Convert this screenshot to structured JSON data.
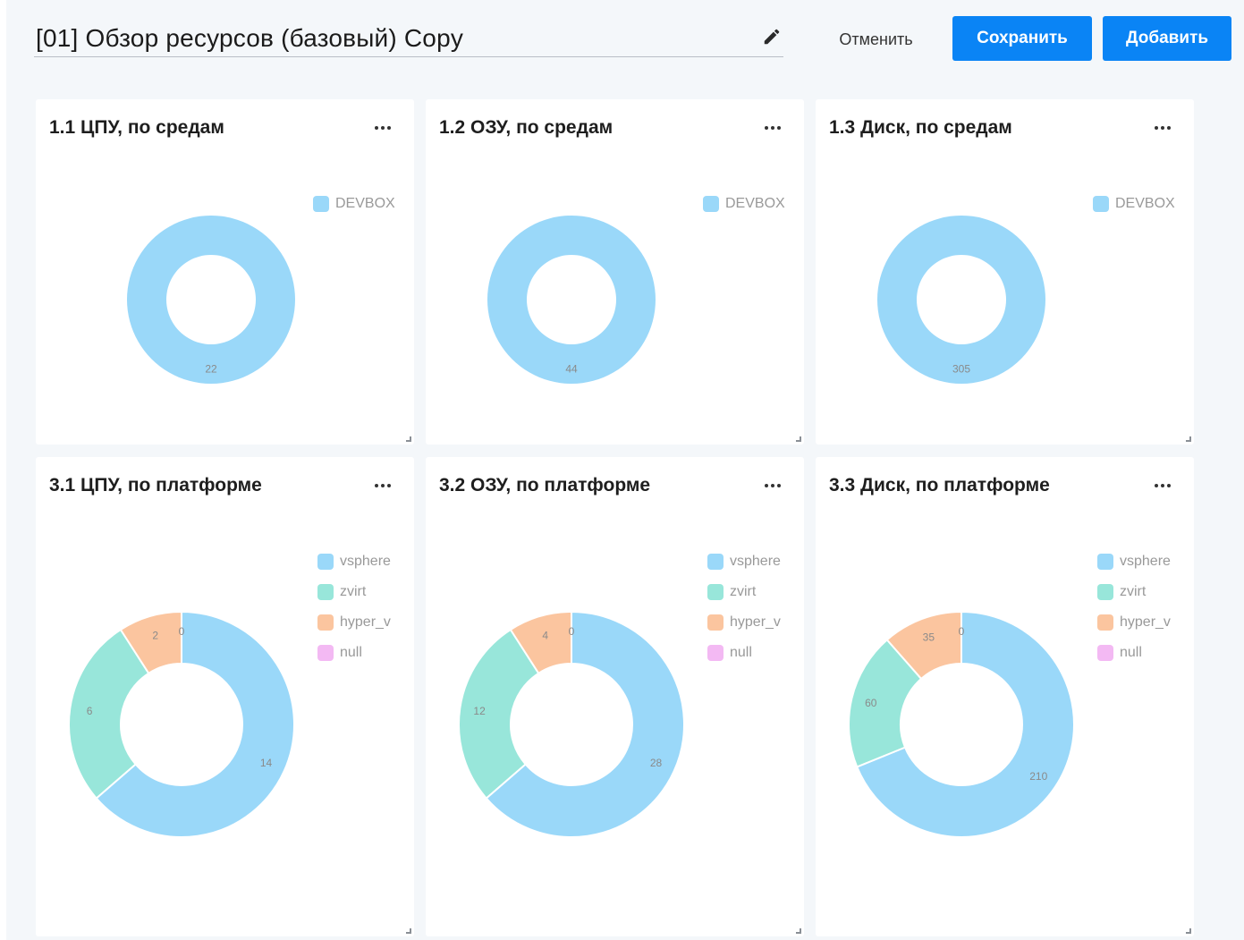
{
  "header": {
    "title": "[01] Обзор ресурсов  (базовый) Copy",
    "cancel_label": "Отменить",
    "save_label": "Сохранить",
    "add_label": "Добавить"
  },
  "colors": {
    "accent": "#0a84f5",
    "vsphere": "#9ad8f9",
    "zvirt": "#98e6da",
    "hyper_v": "#fbc59f",
    "null": "#f3b9f3",
    "devbox": "#9ad8f9"
  },
  "panels": [
    {
      "title": "1.1 ЦПУ, по средам"
    },
    {
      "title": "1.2 ОЗУ, по средам"
    },
    {
      "title": "1.3 Диск, по средам"
    },
    {
      "title": "3.1 ЦПУ, по платформе"
    },
    {
      "title": "3.2 ОЗУ, по платформе"
    },
    {
      "title": "3.3 Диск, по платформе"
    }
  ],
  "chart_data": [
    {
      "type": "pie",
      "title": "1.1 ЦПУ, по средам",
      "categories": [
        "DEVBOX"
      ],
      "values": [
        22
      ],
      "legend": "top-right",
      "donut": true
    },
    {
      "type": "pie",
      "title": "1.2 ОЗУ, по средам",
      "categories": [
        "DEVBOX"
      ],
      "values": [
        44
      ],
      "legend": "top-right",
      "donut": true
    },
    {
      "type": "pie",
      "title": "1.3 Диск, по средам",
      "categories": [
        "DEVBOX"
      ],
      "values": [
        305
      ],
      "legend": "top-right",
      "donut": true
    },
    {
      "type": "pie",
      "title": "3.1 ЦПУ, по платформе",
      "categories": [
        "vsphere",
        "zvirt",
        "hyper_v",
        "null"
      ],
      "values": [
        14,
        6,
        2,
        0
      ],
      "legend": "top-right",
      "donut": true
    },
    {
      "type": "pie",
      "title": "3.2 ОЗУ, по платформе",
      "categories": [
        "vsphere",
        "zvirt",
        "hyper_v",
        "null"
      ],
      "values": [
        28,
        12,
        4,
        0
      ],
      "legend": "top-right",
      "donut": true
    },
    {
      "type": "pie",
      "title": "3.3 Диск, по платформе",
      "categories": [
        "vsphere",
        "zvirt",
        "hyper_v",
        "null"
      ],
      "values": [
        210,
        60,
        35,
        0
      ],
      "legend": "top-right",
      "donut": true
    }
  ]
}
